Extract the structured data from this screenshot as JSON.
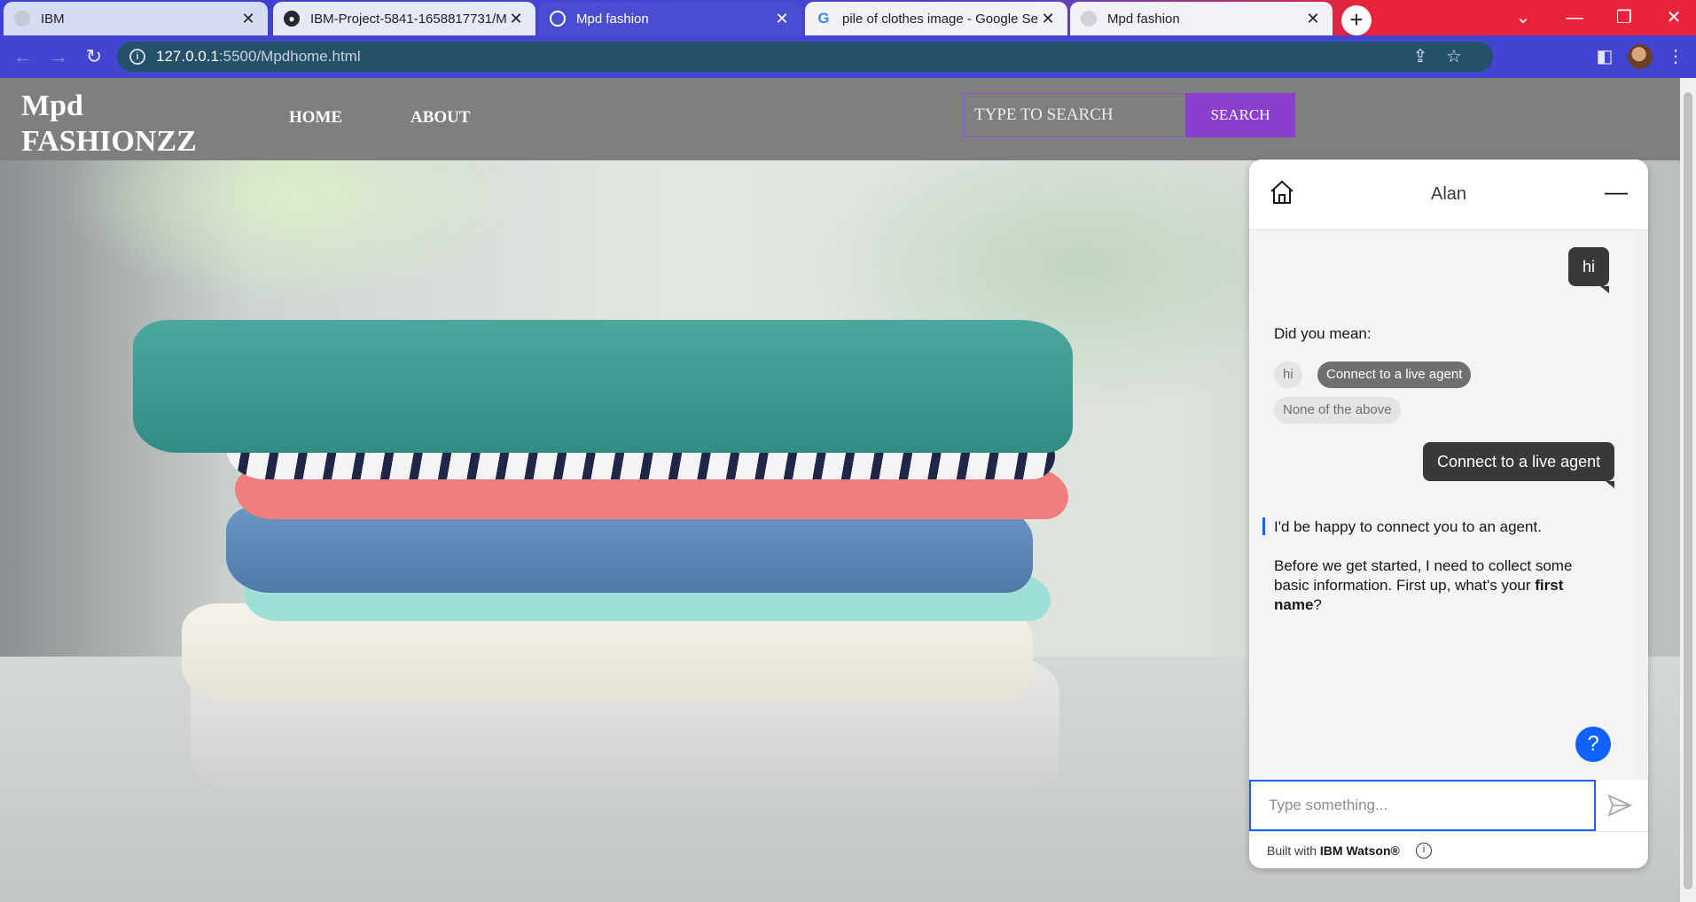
{
  "browser": {
    "tabs": [
      {
        "title": "IBM",
        "icon": "ibm-favicon"
      },
      {
        "title": "IBM-Project-5841-1658817731/M",
        "icon": "github-icon"
      },
      {
        "title": "Mpd fashion",
        "icon": "globe-icon"
      },
      {
        "title": "pile of clothes image - Google Se",
        "icon": "google-icon"
      },
      {
        "title": "Mpd fashion",
        "icon": "globe-icon"
      }
    ],
    "url_host": "127.0.0.1",
    "url_rest": ":5500/Mpdhome.html"
  },
  "site": {
    "logo_line1": "Mpd",
    "logo_line2": "FASHIONZZ",
    "nav": [
      "HOME",
      "ABOUT"
    ],
    "search_placeholder": "TYPE TO SEARCH",
    "search_button": "SEARCH"
  },
  "chat": {
    "agent_name": "Alan",
    "messages": {
      "user_hi": "hi",
      "did_you_mean": "Did you mean:",
      "chips": [
        "hi",
        "Connect to a live agent",
        "None of the above"
      ],
      "user_connect": "Connect to a live agent",
      "bot_reply_1": "I'd be happy to connect you to an agent.",
      "bot_reply_2_prefix": "Before we get started, I need to collect some basic information. First up, what's your ",
      "bot_reply_2_bold": "first name",
      "bot_reply_2_suffix": "?"
    },
    "input_placeholder": "Type something...",
    "footer_prefix": "Built with ",
    "footer_brand": "IBM Watson®",
    "help_label": "?"
  },
  "colors": {
    "accent_blue": "#0f62fe",
    "search_button": "#8a3fcf",
    "header_bg": "#7f7f7f"
  }
}
